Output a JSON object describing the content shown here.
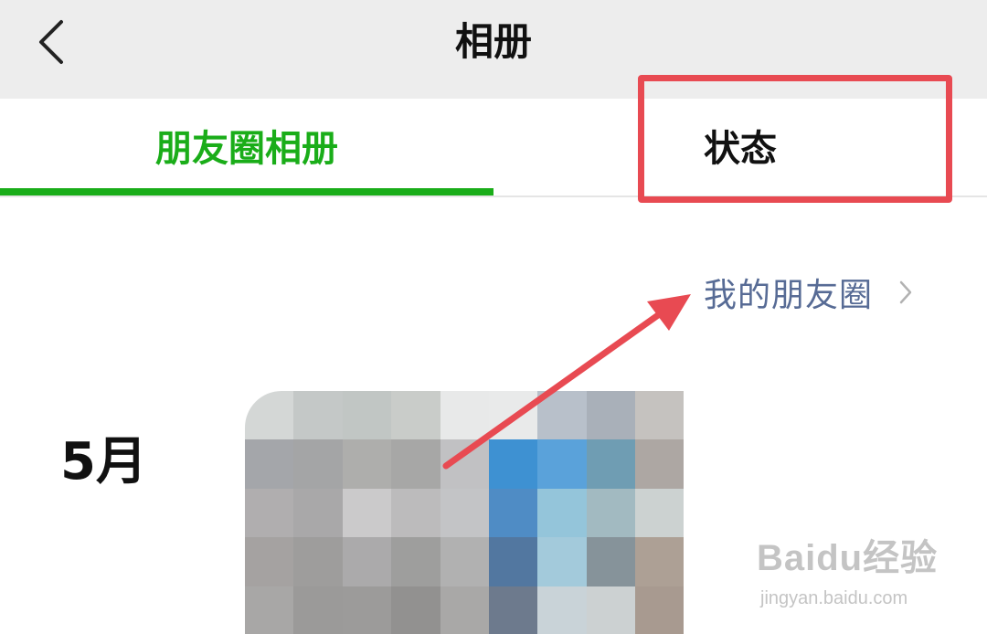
{
  "header": {
    "back_icon": "chevron-left-icon",
    "title": "相册"
  },
  "tabs": [
    {
      "label": "朋友圈相册",
      "active": true
    },
    {
      "label": "状态",
      "active": false
    }
  ],
  "colors": {
    "accent": "#1aad19",
    "link": "#576b95",
    "annotation": "#e84a52",
    "header_bg": "#ededed"
  },
  "moments_link": {
    "label": "我的朋友圈",
    "chevron_icon": "chevron-right-icon"
  },
  "timeline": {
    "month": "5月"
  },
  "watermark": {
    "brand": "Baidu经验",
    "url": "jingyan.baidu.com"
  }
}
